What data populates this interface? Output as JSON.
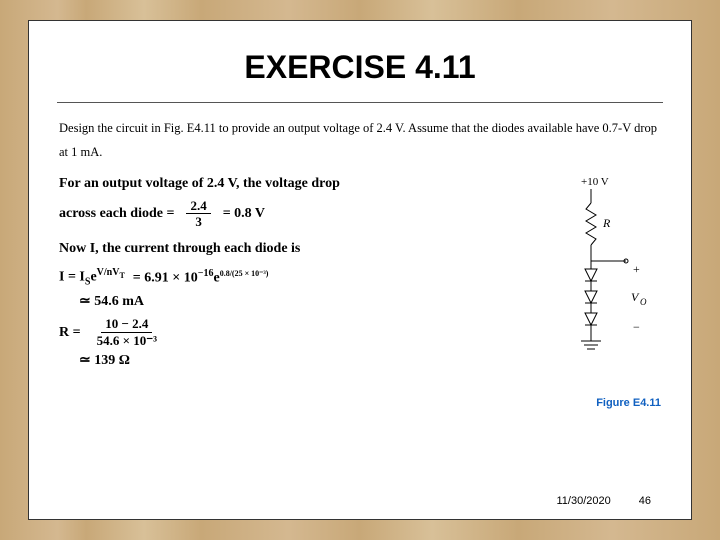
{
  "title": "EXERCISE 4.11",
  "problem": "Design the circuit in Fig. E4.11 to provide an output voltage of 2.4 V. Assume that the diodes available have 0.7-V drop at 1 mA.",
  "sol": {
    "line1": "For an output voltage of 2.4 V, the voltage drop",
    "line2_lhs": "across each diode =",
    "frac1_num": "2.4",
    "frac1_den": "3",
    "line2_rhs": "= 0.8 V",
    "now_text": "Now I, the current through each diode is",
    "eqI_lhs": "I  =  I",
    "eqI_sub": "S",
    "eqI_exp1": "e",
    "eqI_exp1_sup": "V/nV",
    "eqI_exp1_subT": "T",
    "eqI_mid": "=  6.91 × 10",
    "eqI_mid_sup": "−16",
    "eqI_e2": "e",
    "eqI_e2_sup": "0.8/(25 × 10⁻³)",
    "eqI_res": "≃  54.6 mA",
    "eqR_lhs": "R  =",
    "fracR_num": "10 − 2.4",
    "fracR_den": "54.6 × 10⁻³",
    "eqR_res": "≃  139 Ω"
  },
  "circuit": {
    "vcc": "+10 V",
    "r": "R",
    "plus": "+",
    "vo": "V",
    "vo_sub": "O",
    "minus": "−",
    "caption": "Figure E4.11"
  },
  "footer": {
    "date": "11/30/2020",
    "page": "46"
  }
}
